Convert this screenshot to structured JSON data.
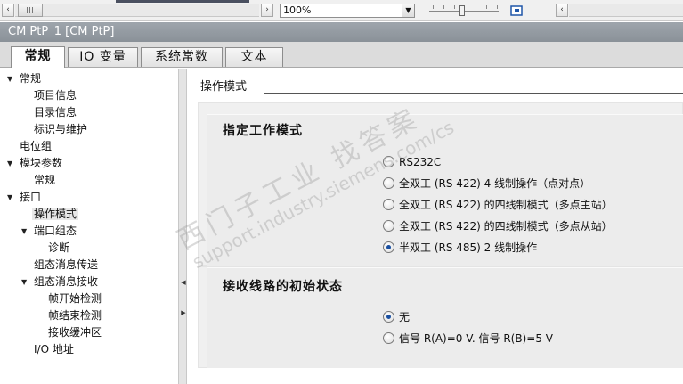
{
  "toolbar": {
    "zoom_value": "100%",
    "scroll_left_glyph": "‹",
    "scroll_right_glyph": "›",
    "dropdown_glyph": "▼"
  },
  "window": {
    "title": "CM PtP_1 [CM PtP]"
  },
  "tabs": [
    {
      "label": "常规",
      "active": true
    },
    {
      "label": "IO 变量",
      "active": false
    },
    {
      "label": "系统常数",
      "active": false
    },
    {
      "label": "文本",
      "active": false
    }
  ],
  "tree": [
    {
      "label": "常规",
      "level": 0,
      "expanded": true
    },
    {
      "label": "项目信息",
      "level": 1
    },
    {
      "label": "目录信息",
      "level": 1
    },
    {
      "label": "标识与维护",
      "level": 1
    },
    {
      "label": "电位组",
      "level": 0
    },
    {
      "label": "模块参数",
      "level": 0,
      "expanded": true
    },
    {
      "label": "常规",
      "level": 1
    },
    {
      "label": "接口",
      "level": 0,
      "expanded": true
    },
    {
      "label": "操作模式",
      "level": 1,
      "selected": true
    },
    {
      "label": "端口组态",
      "level": 1,
      "expanded": true
    },
    {
      "label": "诊断",
      "level": 2
    },
    {
      "label": "组态消息传送",
      "level": 1
    },
    {
      "label": "组态消息接收",
      "level": 1,
      "expanded": true
    },
    {
      "label": "帧开始检测",
      "level": 2
    },
    {
      "label": "帧结束检测",
      "level": 2
    },
    {
      "label": "接收缓冲区",
      "level": 2
    },
    {
      "label": "I/O 地址",
      "level": 1
    }
  ],
  "content": {
    "section_title": "操作模式",
    "group1": {
      "title": "指定工作模式",
      "options": [
        {
          "label": "RS232C",
          "selected": false
        },
        {
          "label": "全双工 (RS 422) 4 线制操作（点对点）",
          "selected": false
        },
        {
          "label": "全双工 (RS 422) 的四线制模式（多点主站）",
          "selected": false
        },
        {
          "label": "全双工 (RS 422) 的四线制模式（多点从站）",
          "selected": false
        },
        {
          "label": "半双工 (RS 485) 2 线制操作",
          "selected": true
        }
      ]
    },
    "group2": {
      "title": "接收线路的初始状态",
      "options": [
        {
          "label": "无",
          "selected": true
        },
        {
          "label": "信号 R(A)=0 V. 信号 R(B)=5 V",
          "selected": false
        }
      ]
    }
  },
  "watermark": {
    "line1": "西门子工业 找答案",
    "line2": "support.industry.siemens.com/cs"
  }
}
